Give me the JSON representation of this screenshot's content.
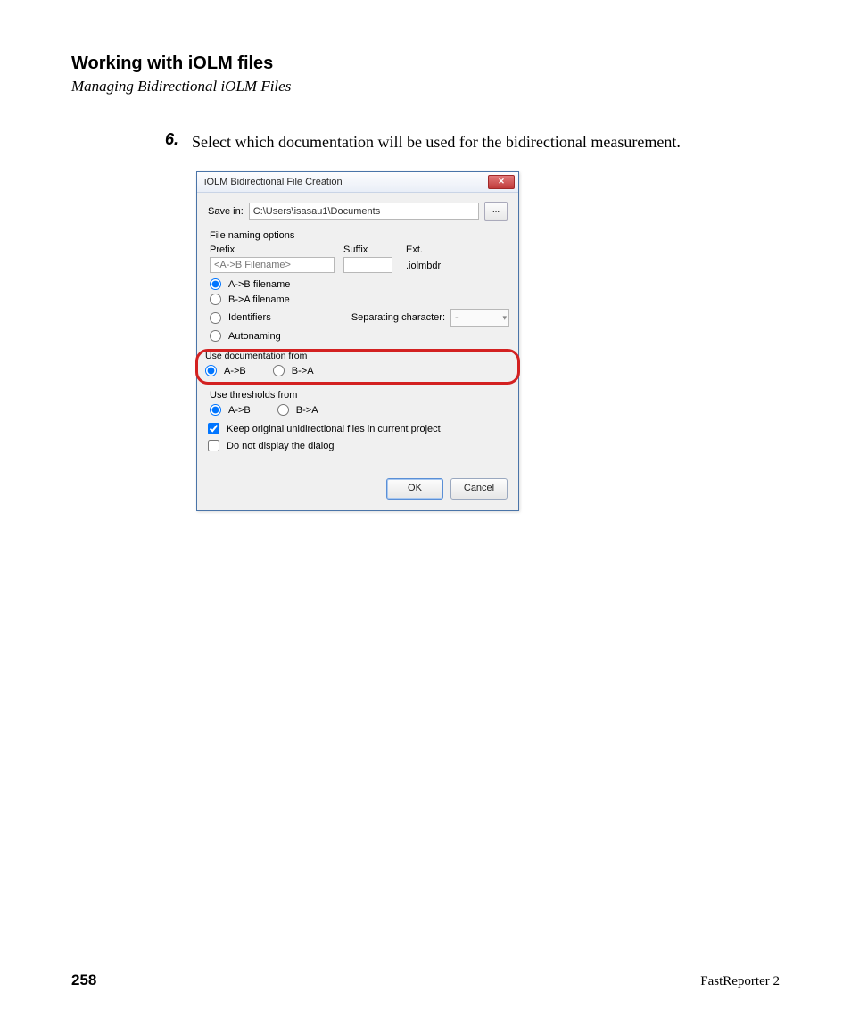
{
  "header": {
    "title": "Working with iOLM files",
    "subtitle": "Managing Bidirectional iOLM Files"
  },
  "step": {
    "number": "6.",
    "text": "Select which documentation will be used for the bidirectional measurement."
  },
  "dialog": {
    "title": "iOLM Bidirectional File Creation",
    "save_in_label": "Save in:",
    "save_path": "C:\\Users\\isasau1\\Documents",
    "browse": "...",
    "file_naming_options": "File naming options",
    "prefix_label": "Prefix",
    "suffix_label": "Suffix",
    "ext_label": "Ext.",
    "prefix_placeholder": "<A->B Filename>",
    "ext_value": ".iolmbdr",
    "radios": {
      "ab_filename": "A->B filename",
      "ba_filename": "B->A filename",
      "identifiers": "Identifiers",
      "autonaming": "Autonaming"
    },
    "sep_label": "Separating character:",
    "sep_value": "-",
    "use_doc_from": "Use documentation from",
    "doc_ab": "A->B",
    "doc_ba": "B->A",
    "use_thresh_from": "Use thresholds from",
    "thresh_ab": "A->B",
    "thresh_ba": "B->A",
    "keep_original": "Keep original unidirectional files in current project",
    "do_not_display": "Do not display the dialog",
    "ok": "OK",
    "cancel": "Cancel"
  },
  "footer": {
    "page": "258",
    "product": "FastReporter 2"
  }
}
